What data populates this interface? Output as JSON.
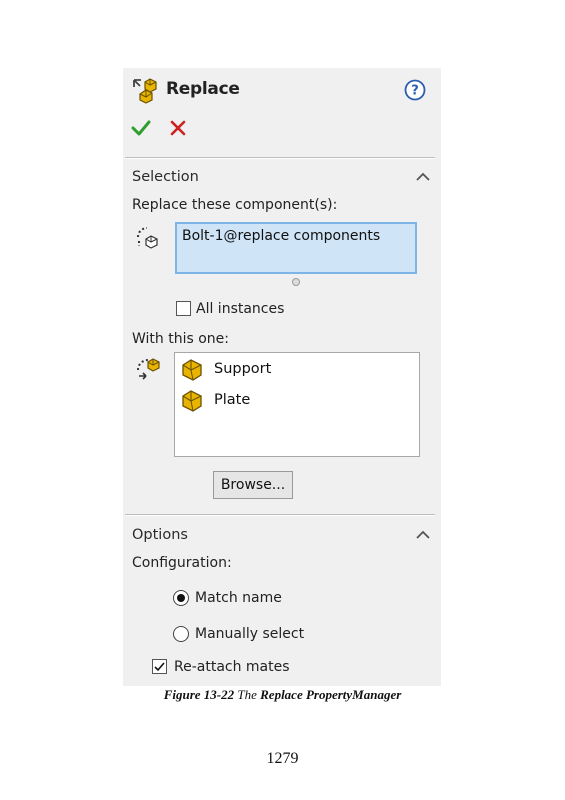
{
  "property_manager": {
    "title": "Replace",
    "selection": {
      "section_title": "Selection",
      "replace_label": "Replace these component(s):",
      "selected_component": "Bolt-1@replace components",
      "all_instances_label": "All instances",
      "all_instances_checked": false,
      "with_label": "With this one:",
      "components": [
        "Support",
        "Plate"
      ],
      "browse_label": "Browse..."
    },
    "options": {
      "section_title": "Options",
      "configuration_label": "Configuration:",
      "radio_match": "Match name",
      "radio_manual": "Manually select",
      "selected_radio": "Match name",
      "reattach_label": "Re-attach mates",
      "reattach_checked": true
    }
  },
  "caption": {
    "figure": "Figure 13-22",
    "the": "The",
    "name": "Replace PropertyManager"
  },
  "page_number": "1279",
  "colors": {
    "accept": "#2e9e2e",
    "cancel": "#cc2222",
    "selection_fill": "#cfe4f7",
    "part_icon": "#e8b400"
  }
}
